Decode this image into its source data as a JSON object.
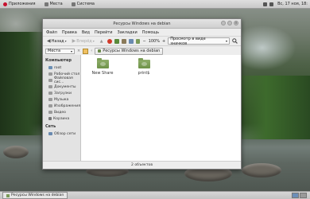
{
  "top_panel": {
    "menus": [
      {
        "label": "Приложения",
        "icon": "debian-swirl-icon",
        "color": "#c8102e"
      },
      {
        "label": "Места",
        "icon": "places-icon",
        "color": "#777777"
      },
      {
        "label": "Система",
        "icon": "system-icon",
        "color": "#777777"
      }
    ],
    "clock": "Вс, 17 ноя, 18:"
  },
  "window": {
    "title": "Ресурсы Windows на debian",
    "menubar": [
      "Файл",
      "Правка",
      "Вид",
      "Перейти",
      "Закладки",
      "Помощь"
    ],
    "toolbar": {
      "back_label": "Назад",
      "forward_label": "Вперёд",
      "zoom": "100%",
      "view_mode": "Просмотр в виде значков"
    },
    "places_selector": "Места",
    "breadcrumb": "Ресурсы Windows на debian",
    "sidebar": {
      "computer_header": "Компьютер",
      "computer_items": [
        {
          "label": "root",
          "icon": "home-folder-icon"
        },
        {
          "label": "Рабочий стол",
          "icon": "desktop-icon"
        },
        {
          "label": "Файловая сис...",
          "icon": "drive-icon"
        },
        {
          "label": "Документы",
          "icon": "folder-icon"
        },
        {
          "label": "Загрузки",
          "icon": "folder-icon"
        },
        {
          "label": "Музыка",
          "icon": "folder-icon"
        },
        {
          "label": "Изображения",
          "icon": "folder-icon"
        },
        {
          "label": "Видео",
          "icon": "folder-icon"
        },
        {
          "label": "Корзина",
          "icon": "trash-icon"
        }
      ],
      "network_header": "Сеть",
      "network_items": [
        {
          "label": "Обзор сети",
          "icon": "network-icon"
        }
      ]
    },
    "files": [
      {
        "label": "New Share",
        "icon": "shared-folder-icon"
      },
      {
        "label": "print$",
        "icon": "shared-folder-icon"
      }
    ],
    "status": "2 объектов"
  },
  "taskbar": {
    "task_label": "Ресурсы Windows на debian"
  }
}
